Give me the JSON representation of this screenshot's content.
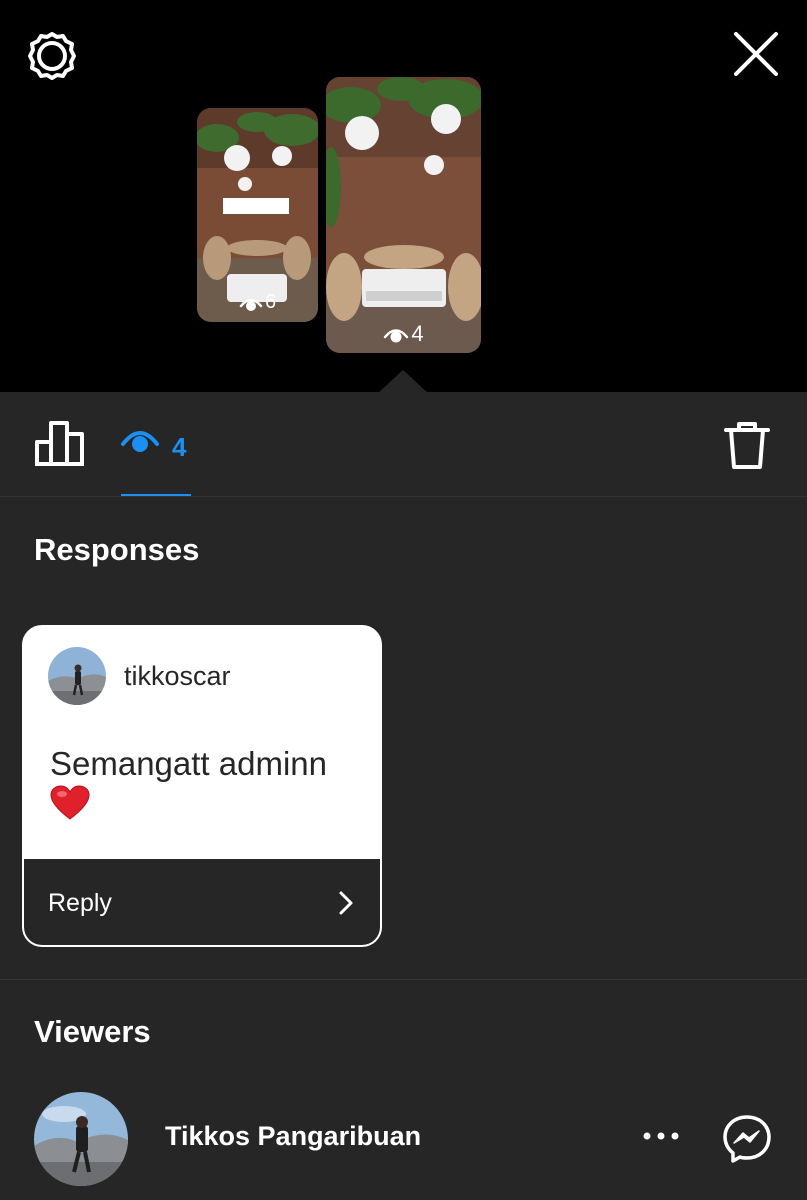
{
  "top": {
    "icons": [
      "settings-icon",
      "close-icon"
    ],
    "stories": [
      {
        "views": "6",
        "selected": false
      },
      {
        "views": "4",
        "selected": true
      }
    ]
  },
  "tabs": {
    "insights_icon": "bar-chart-icon",
    "views_icon": "eye-icon",
    "views_count": "4",
    "delete_icon": "trash-icon",
    "accent_color": "#1b8ff2"
  },
  "responses": {
    "title": "Responses",
    "items": [
      {
        "username": "tikkoscar",
        "message": "Semangatt adminn",
        "emoji": "heart",
        "reply_label": "Reply"
      }
    ]
  },
  "viewers": {
    "title": "Viewers",
    "items": [
      {
        "name": "Tikkos Pangaribuan",
        "actions": [
          "more-icon",
          "messenger-icon"
        ]
      }
    ]
  }
}
